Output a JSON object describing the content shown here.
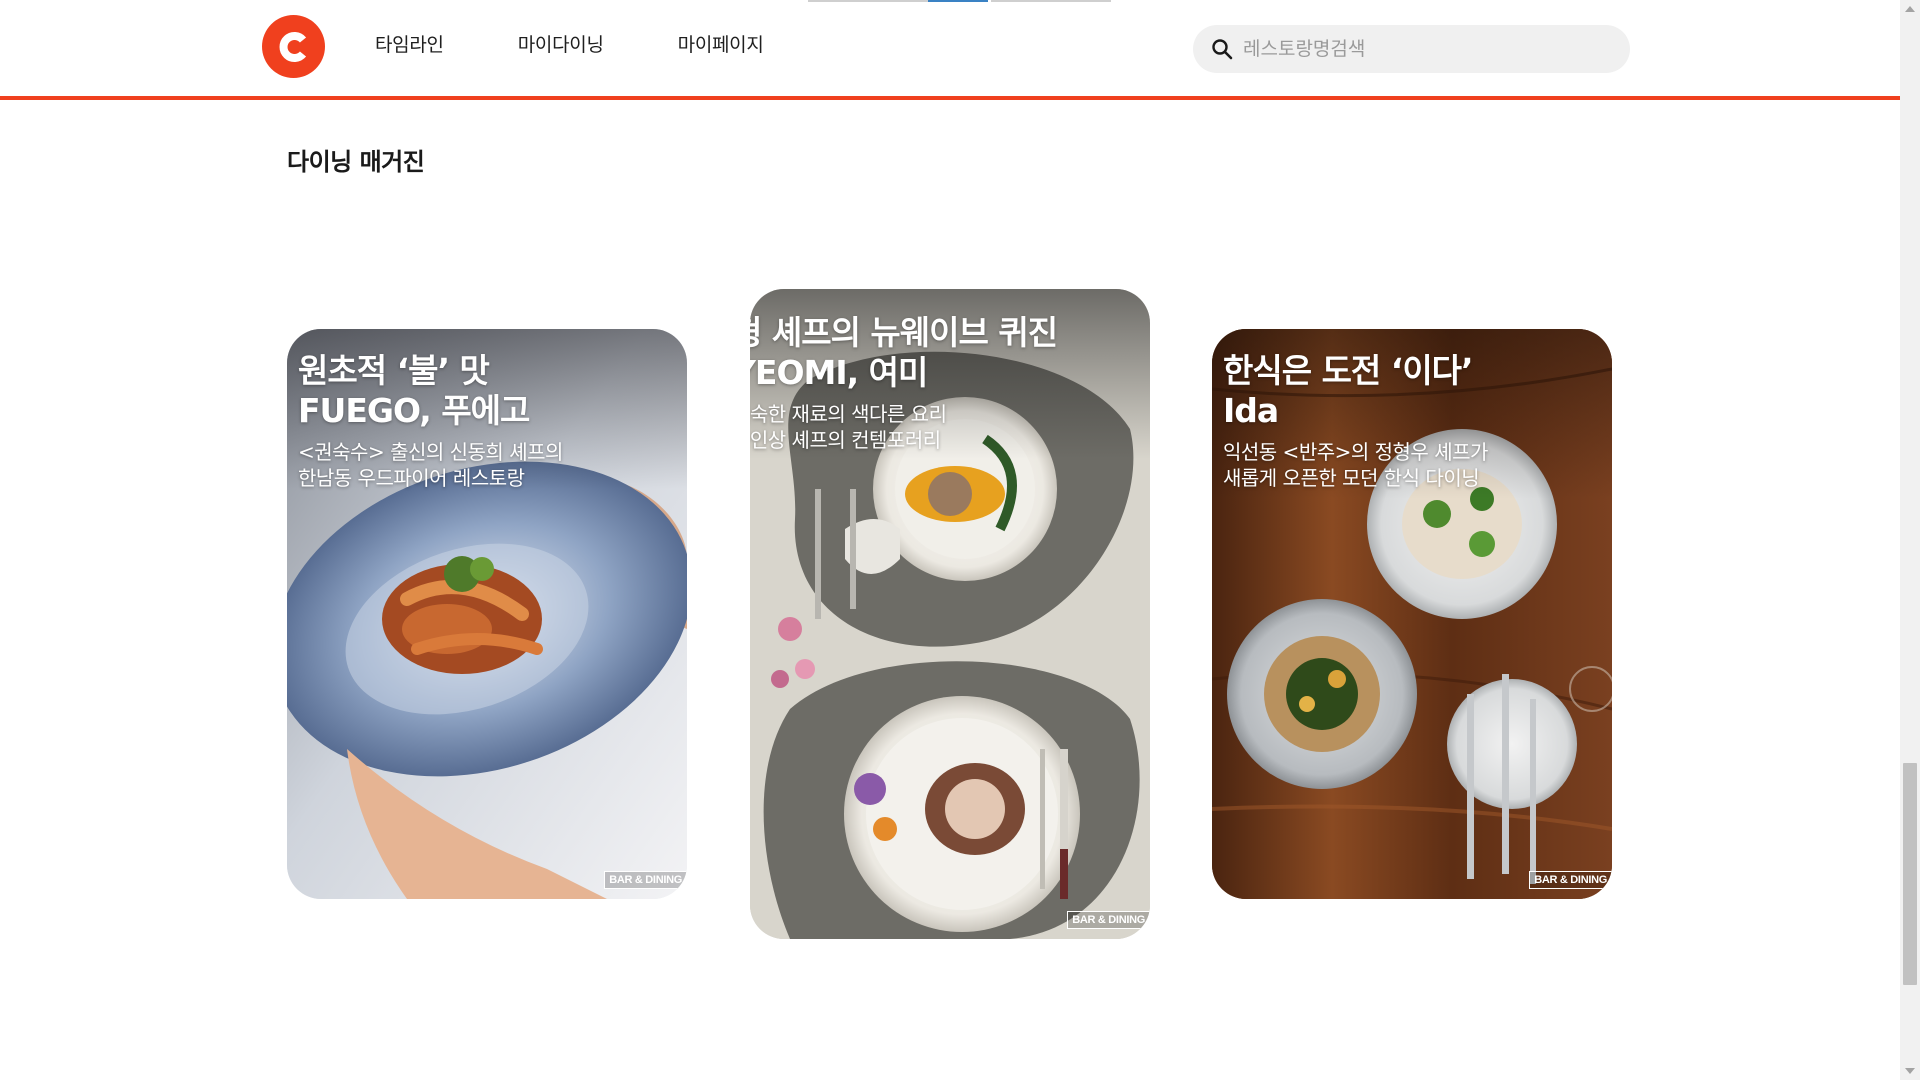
{
  "header": {
    "logo_letter": "C",
    "nav": [
      "타임라인",
      "마이다이닝",
      "마이페이지"
    ],
    "search_placeholder": "레스토랑명검색"
  },
  "section": {
    "title": "다이닝 매거진"
  },
  "cards": [
    {
      "headline_1": "원초적 ‘불’ 맛",
      "headline_2": "FUEGO, 푸에고",
      "sub_1": "<권숙수> 출신의 신동희 셰프의",
      "sub_2": "한남동 우드파이어 레스토랑",
      "badge": "BAR & DINING"
    },
    {
      "headline_1": "형 셰프의 뉴웨이브 퀴진",
      "headline_2": "YEOMI, 여미",
      "sub_1": "익숙한 재료의 색다른 요리",
      "sub_2": "형인상 셰프의 컨템포러리",
      "badge": "BAR & DINING"
    },
    {
      "headline_1": "한식은 도전 ‘이다’",
      "headline_2": "Ida",
      "sub_1": "익선동 <반주>의 정형우 셰프가",
      "sub_2": "새롭게 오픈한 모던 한식 다이닝",
      "badge": "BAR & DINING"
    }
  ],
  "colors": {
    "brand": "#f0401e",
    "active_tab": "#3a82c4"
  }
}
